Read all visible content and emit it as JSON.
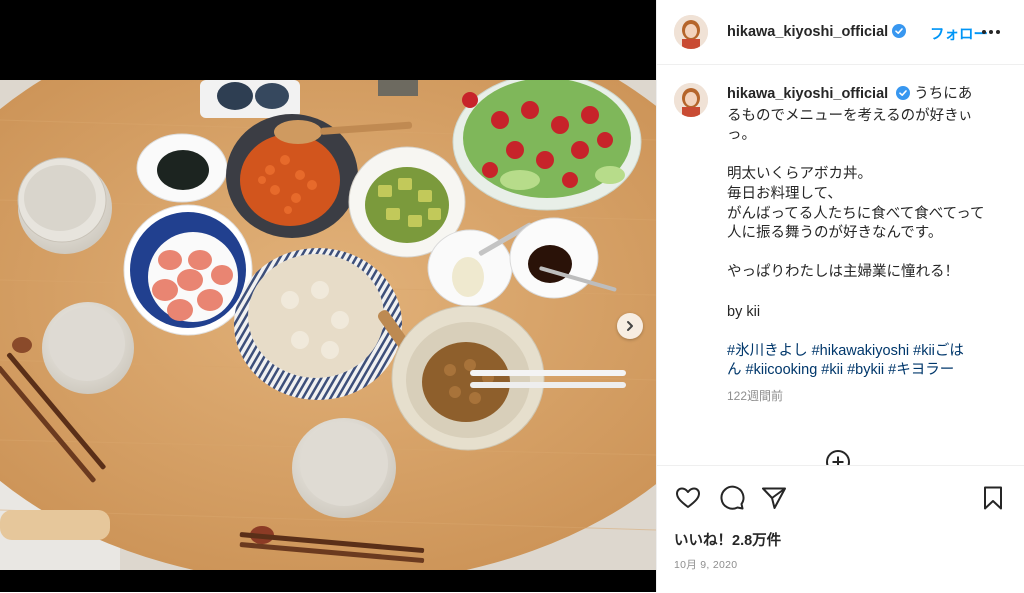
{
  "post": {
    "username": "hikawa_kiyoshi_official",
    "follow_label": "フォロー",
    "caption_lines": [
      "うちにあ",
      "るものでメニューを考えるのが好きぃ",
      "っ。",
      "",
      "明太いくらアボカ丼。",
      "毎日お料理して、",
      "がんばってる人たちに食べて食べてって",
      "人に振る舞うのが好きなんです。",
      "",
      "やっぱりわたしは主婦業に憧れる！",
      "",
      "by kii",
      ""
    ],
    "hashtags_line1": "#氷川きよし #hikawakiyoshi #kiiごは",
    "hashtags_line2": "ん #kiicooking #kii #bykii #キヨラー",
    "time_ago": "122週間前",
    "likes": "いいね！2.8万件",
    "date": "10月 9, 2020"
  },
  "icons": {
    "verified": "verified-badge-icon",
    "more": "more-options-icon",
    "next": "chevron-right-icon",
    "add_comment": "add-circle-icon",
    "like": "heart-icon",
    "comment": "comment-icon",
    "share": "share-icon",
    "save": "bookmark-icon"
  },
  "colors": {
    "accent": "#0095f6",
    "hashtag": "#00376b",
    "muted": "#8e8e8e",
    "verified": "#3897f0"
  }
}
